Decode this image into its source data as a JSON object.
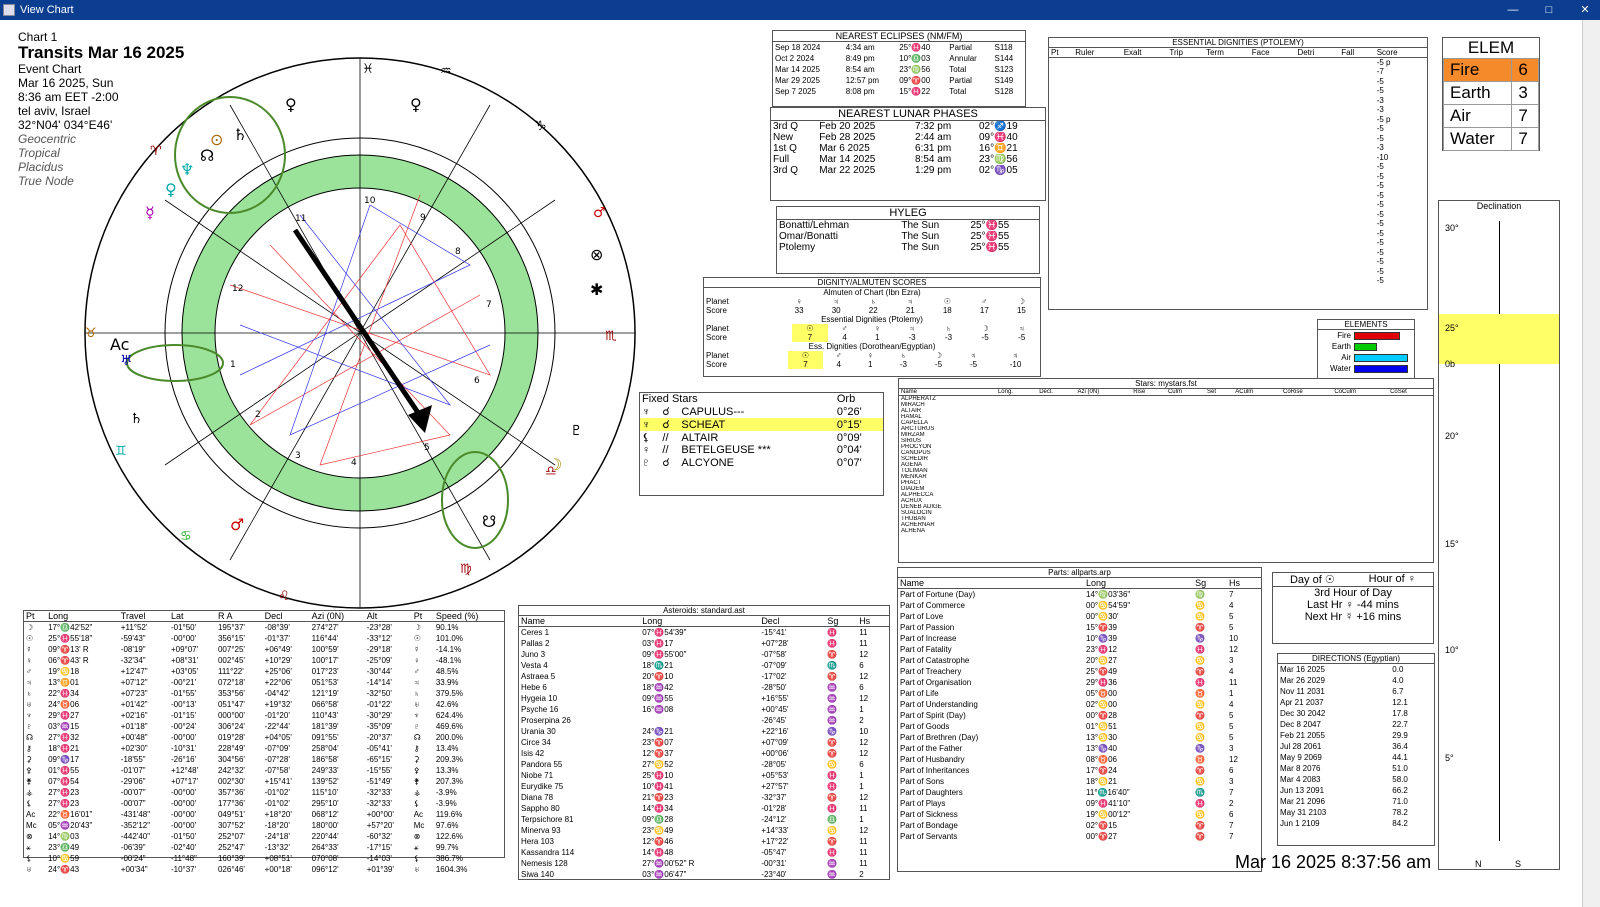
{
  "window": {
    "title": "View Chart"
  },
  "chart_info": {
    "label": "Chart 1",
    "title": "Transits Mar 16 2025",
    "type": "Event Chart",
    "date": "Mar 16 2025, Sun",
    "time": "8:36 am  EET -2:00",
    "place": "tel aviv, Israel",
    "coords": "32°N04' 034°E46'",
    "zodiac": "Geocentric",
    "tropical": "Tropical",
    "houses": "Placidus",
    "node": "True Node"
  },
  "eclipses": {
    "title": "NEAREST ECLIPSES (NM/FM)",
    "rows": [
      [
        "Sep 18 2024",
        "4:34 am",
        "25°♓40",
        "Partial",
        "S118"
      ],
      [
        "Oct 2 2024",
        "8:49 pm",
        "10°♎03",
        "Annular",
        "S144"
      ],
      [
        "Mar 14 2025",
        "8:54 am",
        "23°♍56",
        "Total",
        "S123"
      ],
      [
        "Mar 29 2025",
        "12:57 pm",
        "09°♈00",
        "Partial",
        "S149"
      ],
      [
        "Sep 7 2025",
        "8:08 pm",
        "15°♓22",
        "Total",
        "S128"
      ]
    ]
  },
  "lunar": {
    "title": "NEAREST LUNAR PHASES",
    "rows": [
      [
        "3rd Q",
        "Feb 20 2025",
        "7:32 pm",
        "02°♐19"
      ],
      [
        "New",
        "Feb 28 2025",
        "2:44 am",
        "09°♓40"
      ],
      [
        "1st Q",
        "Mar 6 2025",
        "6:31 pm",
        "16°♊21"
      ],
      [
        "Full",
        "Mar 14 2025",
        "8:54 am",
        "23°♍56"
      ],
      [
        "3rd Q",
        "Mar 22 2025",
        "1:29 pm",
        "02°♑05"
      ]
    ]
  },
  "hyleg": {
    "title": "HYLEG",
    "rows": [
      [
        "Bonatti/Lehman",
        "The Sun",
        "25°♓55"
      ],
      [
        "Omar/Bonatti",
        "The Sun",
        "25°♓55"
      ],
      [
        "Ptolemy",
        "The Sun",
        "25°♓55"
      ]
    ]
  },
  "dignity": {
    "title": "DIGNITY/ALMUTEN SCORES",
    "sub1": "Almuten of Chart (Ibn Ezra)",
    "sub2": "Essential Dignities (Ptolemy)",
    "sub3": "Ess. Dignities (Dorothean/Egyptian)",
    "planet_label": "Planet",
    "score_label": "Score",
    "r1p": [
      "♀",
      "♃",
      "♄",
      "♃",
      "☉",
      "♂",
      "☽"
    ],
    "r1s": [
      "33",
      "30",
      "22",
      "21",
      "18",
      "17",
      "15"
    ],
    "r2p": [
      "☉",
      "♂",
      "♀",
      "♃",
      "♄",
      "☽",
      "♃"
    ],
    "r2s": [
      "7",
      "4",
      "1",
      "-3",
      "-3",
      "-5",
      "-5"
    ],
    "r3p": [
      "☉",
      "♂",
      "♀",
      "♄",
      "☽",
      "♃",
      "♃"
    ],
    "r3s": [
      "7",
      "4",
      "1",
      "-3",
      "-5",
      "-5",
      "-10"
    ]
  },
  "fixed_stars": {
    "title": "Fixed Stars",
    "orb_label": "Orb",
    "rows": [
      [
        "♆",
        "☌",
        "CAPULUS---",
        "0°26'"
      ],
      [
        "♆",
        "☌",
        "SCHEAT",
        "0°15'"
      ],
      [
        "⚸",
        "//",
        "ALTAIR",
        "0°09'"
      ],
      [
        "♀",
        "//",
        "BETELGEUSE ***",
        "0°04'"
      ],
      [
        "♇",
        "☌",
        "ALCYONE",
        "0°07'"
      ]
    ]
  },
  "elem": {
    "title": "ELEM",
    "rows": [
      [
        "Fire",
        "6"
      ],
      [
        "Earth",
        "3"
      ],
      [
        "Air",
        "7"
      ],
      [
        "Water",
        "7"
      ]
    ]
  },
  "elements_bars": {
    "title": "ELEMENTS",
    "labels": [
      "Fire",
      "Earth",
      "Air",
      "Water"
    ],
    "values": [
      6,
      3,
      7,
      7
    ],
    "colors": [
      "#e00000",
      "#00cc00",
      "#00ccff",
      "#0000ee"
    ]
  },
  "essential": {
    "title": "ESSENTIAL DIGNITIES (PTOLEMY)",
    "cols": [
      "Pt",
      "Ruler",
      "Exalt",
      "Trip",
      "Term",
      "Face",
      "Detri",
      "Fall",
      "Score"
    ],
    "scores": [
      "-5 p",
      "-7",
      "-5",
      "-5",
      "-3",
      "-3",
      "-5 p",
      "-5",
      "-5",
      "-3",
      "-10",
      "-5",
      "-5",
      "-5",
      "-5",
      "-5",
      "-5",
      "-5",
      "-5",
      "-5",
      "-5",
      "-5",
      "-5",
      "-5"
    ]
  },
  "declination": {
    "title": "Declination",
    "ticks": [
      "30°",
      "25°",
      "0b",
      "20°",
      "15°",
      "10°",
      "5°"
    ],
    "footer": [
      "N",
      "S"
    ]
  },
  "day_hour": {
    "day": "Day of ☉",
    "hour": "Hour of ♀",
    "hour_of_day": "3rd Hour of Day",
    "last": "Last Hr  ♀  -44 mins",
    "next": "Next Hr  ☿  +16 mins"
  },
  "directions": {
    "title": "DIRECTIONS (Egyptian)",
    "rows": [
      [
        "Mar 16 2025",
        "0.0"
      ],
      [
        "Mar 26 2029",
        "4.0"
      ],
      [
        "Nov 11 2031",
        "6.7"
      ],
      [
        "Apr 21 2037",
        "12.1"
      ],
      [
        "Dec 30 2042",
        "17.8"
      ],
      [
        "Dec 8 2047",
        "22.7"
      ],
      [
        "Feb 21 2055",
        "29.9"
      ],
      [
        "Jul 28 2061",
        "36.4"
      ],
      [
        "May 9 2069",
        "44.1"
      ],
      [
        "Mar 8 2076",
        "51.0"
      ],
      [
        "Mar 4 2083",
        "58.0"
      ],
      [
        "Jun 13 2091",
        "66.2"
      ],
      [
        "Mar 21 2096",
        "71.0"
      ],
      [
        "May 31 2103",
        "78.2"
      ],
      [
        "Jun 1 2109",
        "84.2"
      ]
    ]
  },
  "positions": {
    "cols": [
      "Pt",
      "Long",
      "Travel",
      "Lat",
      "R A",
      "Decl",
      "Azi (0N)",
      "Alt",
      "Pt",
      "Speed (%)"
    ],
    "rows": [
      [
        "☽",
        "17°♎42'52\"",
        "+11°52'",
        "-01°50'",
        "195°37'",
        "-08°39'",
        "274°27'",
        "-23°28'",
        "☽",
        "90.1%"
      ],
      [
        "☉",
        "25°♓55'18\"",
        "-59'43\"",
        "-00°00'",
        "356°15'",
        "-01°37'",
        "116°44'",
        "-33°12'",
        "☉",
        "101.0%"
      ],
      [
        "☿",
        "09°♈13' R",
        "-08'19\"",
        "+09°07'",
        "007°25'",
        "+06°49'",
        "100°59'",
        "-29°18'",
        "☿",
        "-14.1%"
      ],
      [
        "♀",
        "06°♈43' R",
        "-32'34\"",
        "+08°31'",
        "002°45'",
        "+10°29'",
        "100°17'",
        "-25°09'",
        "♀",
        "-48.1%"
      ],
      [
        "♂",
        "19°♋18",
        "+12'47\"",
        "+03°05'",
        "111°22'",
        "+25°06'",
        "017°23'",
        "-30°44'",
        "♂",
        "48.5%"
      ],
      [
        "♃",
        "13°♊01",
        "+07'12\"",
        "-00°21'",
        "072°18'",
        "+22°06'",
        "051°53'",
        "-14°14'",
        "♃",
        "33.9%"
      ],
      [
        "♄",
        "22°♓34",
        "+07'23\"",
        "-01°55'",
        "353°56'",
        "-04°42'",
        "121°19'",
        "-32°50'",
        "♄",
        "379.5%"
      ],
      [
        "♅",
        "24°♉06",
        "+01'42\"",
        "-00°13'",
        "051°47'",
        "+19°32'",
        "066°58'",
        "-01°22'",
        "♅",
        "42.6%"
      ],
      [
        "♆",
        "29°♓27",
        "+02'16\"",
        "-01°15'",
        "000°00'",
        "-01°20'",
        "110°43'",
        "-30°29'",
        "♆",
        "624.4%"
      ],
      [
        "♇",
        "03°♒15",
        "+01'18\"",
        "-00°24'",
        "306°24'",
        "-22°44'",
        "181°39'",
        "-35°09'",
        "♇",
        "469.6%"
      ],
      [
        "☊",
        "27°♓32",
        "+00'48\"",
        "-00°00'",
        "019°28'",
        "+04°05'",
        "091°55'",
        "-20°37'",
        "☊",
        "200.0%"
      ],
      [
        "⚷",
        "18°♓21",
        "+02'30\"",
        "-10°31'",
        "228°49'",
        "-07°09'",
        "258°04'",
        "-05°41'",
        "⚷",
        "13.4%"
      ],
      [
        "⚳",
        "09°♑17",
        "-18'55\"",
        "-26°16'",
        "304°56'",
        "-07°28'",
        "186°58'",
        "-65°15'",
        "⚳",
        "209.3%"
      ],
      [
        "⚴",
        "01°♓55",
        "-01'07\"",
        "+12°48'",
        "242°32'",
        "-07°58'",
        "249°33'",
        "-15°55'",
        "⚴",
        "13.3%"
      ],
      [
        "⚵",
        "07°♓54",
        "-29'06\"",
        "+07°17'",
        "002°30'",
        "+15°41'",
        "139°52'",
        "-51°49'",
        "⚵",
        "207.3%"
      ],
      [
        "⚶",
        "27°♓23",
        "-00'07\"",
        "-00°00'",
        "357°36'",
        "-01°02'",
        "115°10'",
        "-32°33'",
        "⚶",
        "-3.9%"
      ],
      [
        "⚸",
        "27°♓23",
        "-00'07\"",
        "-00°00'",
        "177°36'",
        "-01°02'",
        "295°10'",
        "-32°33'",
        "⚸",
        "-3.9%"
      ],
      [
        "Ac",
        "22°♉16'01\"",
        "-431'48\"",
        "-00°00'",
        "049°51'",
        "+18°20'",
        "068°12'",
        "+00°00'",
        "Ac",
        "119.6%"
      ],
      [
        "Mc",
        "05°♒20'43\"",
        "-352'12\"",
        "-00°00'",
        "307°52'",
        "-18°20'",
        "180°00'",
        "+57°20'",
        "Mc",
        "97.6%"
      ],
      [
        "⊗",
        "14°♍03",
        "-442'40\"",
        "-01°50'",
        "252°07'",
        "-24°18'",
        "220°44'",
        "-60°32'",
        "⊗",
        "122.6%"
      ],
      [
        "⚹",
        "23°♎49",
        "-06'39\"",
        "-02°40'",
        "252°47'",
        "-13°32'",
        "264°33'",
        "-17°15'",
        "⚹",
        "99.7%"
      ],
      [
        "⚸",
        "10°♋59",
        "-00'24\"",
        "-11°48\"",
        "160°39'",
        "+08°51'",
        "070°08'",
        "-14°03'",
        "⚸",
        "386.7%"
      ],
      [
        "♅",
        "24°♈43",
        "+00'34\"",
        "-10°37'",
        "026°46'",
        "+00°18'",
        "096°12'",
        "+01°39'",
        "♅",
        "1604.3%"
      ]
    ]
  },
  "asteroids": {
    "title": "Asteroids: standard.ast",
    "cols": [
      "Name",
      "Long",
      "Decl",
      "Sg",
      "Hs"
    ],
    "rows": [
      [
        "Ceres 1",
        "07°♓54'39\"",
        "-15°41'",
        "♓",
        "11"
      ],
      [
        "Pallas 2",
        "03°♓17",
        "+07°28'",
        "♓",
        "11"
      ],
      [
        "Juno 3",
        "09°♓55'00\"",
        "-07°58'",
        "♈",
        "12"
      ],
      [
        "Vesta 4",
        "18°♏21",
        "-07°09'",
        "♏",
        "6"
      ],
      [
        "Astraea 5",
        "20°♈10",
        "-17°02'",
        "♈",
        "12"
      ],
      [
        "Hebe 6",
        "18°♒42",
        "-28°50'",
        "♒",
        "6"
      ],
      [
        "Hygeia 10",
        "09°♒55",
        "+16°55'",
        "♒",
        "12"
      ],
      [
        "Psyche 16",
        "16°♒08",
        "+00°45'",
        "♒",
        "1"
      ],
      [
        "Proserpina 26",
        "",
        "-26°45'",
        "♒",
        "2"
      ],
      [
        "Urania 30",
        "24°♑21",
        "+22°16'",
        "♑",
        "10"
      ],
      [
        "Circe 34",
        "23°♈07",
        "+07°09'",
        "♈",
        "12"
      ],
      [
        "Isis 42",
        "12°♈37",
        "+00°06'",
        "♈",
        "12"
      ],
      [
        "Pandora 55",
        "27°♋52",
        "-28°05'",
        "♋",
        "6"
      ],
      [
        "Niobe 71",
        "25°♓10",
        "+05°53'",
        "♓",
        "1"
      ],
      [
        "Eurydike 75",
        "10°♓41",
        "+27°57'",
        "♓",
        "1"
      ],
      [
        "Diana 78",
        "21°♈23",
        "-32°37'",
        "♈",
        "12"
      ],
      [
        "Sappho 80",
        "14°♓34",
        "-01°28'",
        "♓",
        "11"
      ],
      [
        "Terpsichore 81",
        "09°♎28",
        "-24°12'",
        "♎",
        "1"
      ],
      [
        "Minerva 93",
        "23°♋49",
        "+14°33'",
        "♋",
        "12"
      ],
      [
        "Hera 103",
        "12°♈46",
        "+17°22'",
        "♈",
        "11"
      ],
      [
        "Kassandra 114",
        "14°♓48",
        "-05°47'",
        "♓",
        "11"
      ],
      [
        "Nemesis 128",
        "27°♒00'52\" R",
        "-00°31'",
        "♒",
        "11"
      ],
      [
        "Siwa 140",
        "03°♒06'47\"",
        "-23°40'",
        "♒",
        "2"
      ]
    ]
  },
  "parts": {
    "title": "Parts: allparts.arp",
    "cols": [
      "Name",
      "Long",
      "Sg",
      "Hs"
    ],
    "rows": [
      [
        "Part of Fortune (Day)",
        "14°♍03'36\"",
        "♍",
        "7"
      ],
      [
        "Part of Commerce",
        "00°♋54'59\"",
        "♋",
        "4"
      ],
      [
        "Part of Love",
        "00°♋30'",
        "♋",
        "5"
      ],
      [
        "Part of Passion",
        "15°♈39",
        "♈",
        "5"
      ],
      [
        "Part of Increase",
        "10°♑39",
        "♑",
        "10"
      ],
      [
        "Part of Fatality",
        "23°♓12",
        "♓",
        "12"
      ],
      [
        "Part of Catastrophe",
        "20°♋27",
        "♋",
        "3"
      ],
      [
        "Part of Treachery",
        "25°♈49",
        "♈",
        "4"
      ],
      [
        "Part of Organisation",
        "29°♓36",
        "♓",
        "11"
      ],
      [
        "Part of Life",
        "05°♉00",
        "♉",
        "1"
      ],
      [
        "Part of Understanding",
        "02°♋00",
        "♋",
        "4"
      ],
      [
        "Part of Spirit (Day)",
        "00°♈28",
        "♈",
        "5"
      ],
      [
        "Part of Goods",
        "01°♋51",
        "♋",
        "5"
      ],
      [
        "Part of Brethren (Day)",
        "13°♋30",
        "♋",
        "5"
      ],
      [
        "Part of the Father",
        "13°♑40",
        "♑",
        "3"
      ],
      [
        "Part of Husbandry",
        "08°♉06",
        "♉",
        "12"
      ],
      [
        "Part of Inheritances",
        "17°♈24",
        "♈",
        "6"
      ],
      [
        "Part of Sons",
        "18°♋21",
        "♋",
        "3"
      ],
      [
        "Part of Daughters",
        "11°♏16'40\"",
        "♏",
        "7"
      ],
      [
        "Part of Plays",
        "09°♓41'10\"",
        "♓",
        "2"
      ],
      [
        "Part of Sickness",
        "19°♋00'12\"",
        "♋",
        "6"
      ],
      [
        "Part of Bondage",
        "02°♈15",
        "♈",
        "7"
      ],
      [
        "Part of Servants",
        "00°♈27",
        "♈",
        "7"
      ]
    ]
  },
  "stars_table": {
    "title": "Stars: mystars.fst",
    "cols": [
      "Name",
      "Long.",
      "Decl.",
      "Azi (0N)",
      "Rise",
      "Culm",
      "Set",
      "ACulm",
      "CoRise",
      "CoCulm",
      "CoSet"
    ],
    "names": [
      "ALPHERATZ",
      "MIRACH",
      "ALTAIR",
      "HAMAL",
      "CAPELLA",
      "ARCTURUS",
      "MIRZAM",
      "SIRIUS",
      "PROCYON",
      "CANOPUS",
      "SCHEDIR",
      "AGENA",
      "TOLIMAN",
      "MENKAR",
      "PHACT",
      "DIADEM",
      "ALPHECCA",
      "ACRUX",
      "DENEB ADIGE",
      "SUALOCIN",
      "THUBAN",
      "ACHERNAR",
      "ALHENA"
    ]
  },
  "timestamp": "Mar 16 2025   8:37:56 am"
}
